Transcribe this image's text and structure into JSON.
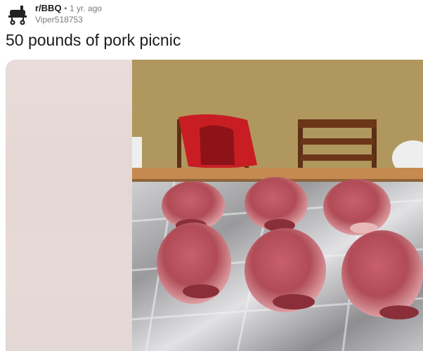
{
  "post": {
    "subreddit": "r/BBQ",
    "separator": "•",
    "age": "1 yr. ago",
    "author": "Viper518753",
    "title": "50 pounds of pork picnic"
  },
  "icons": {
    "avatar": "smoker-grill-icon"
  },
  "colors": {
    "meta_gray": "#787c7e",
    "text": "#1c1c1c"
  }
}
